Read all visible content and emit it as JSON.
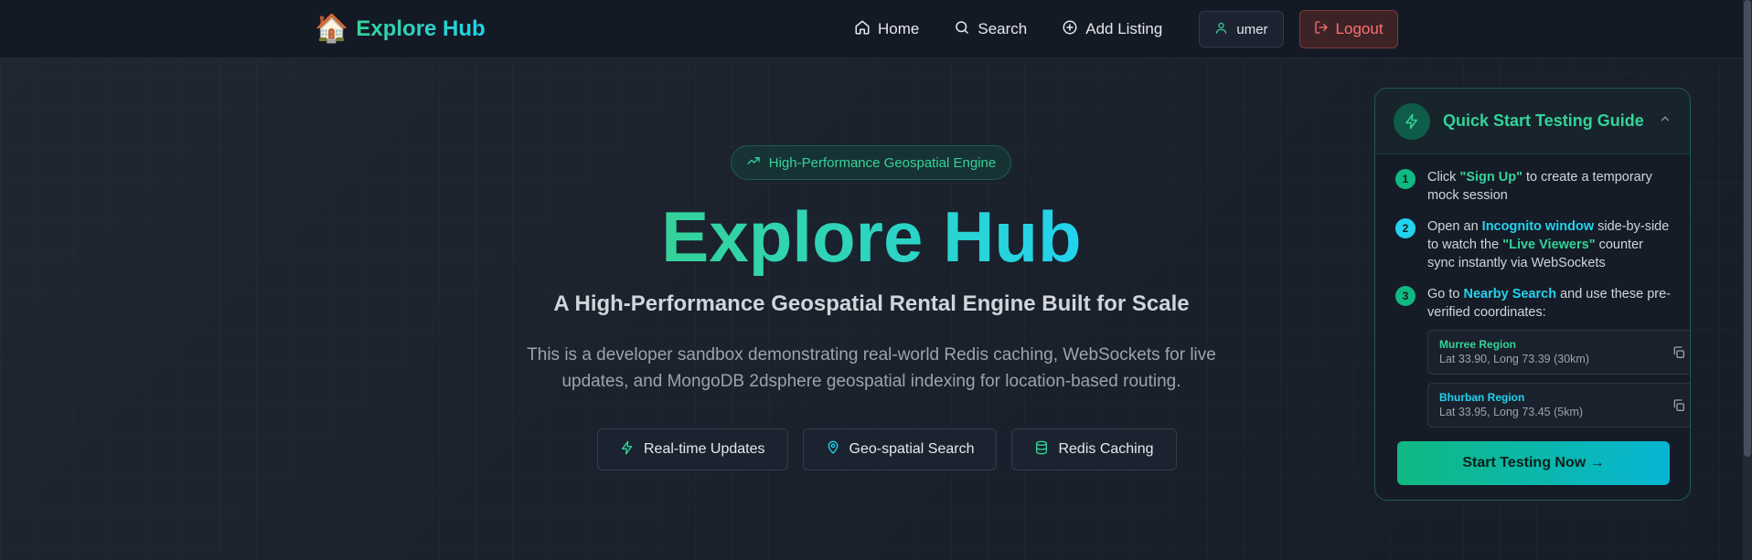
{
  "navbar": {
    "brand_icon": "🏠",
    "brand_name": "Explore Hub",
    "links": [
      {
        "label": "Home",
        "icon": "home-icon"
      },
      {
        "label": "Search",
        "icon": "search-icon"
      },
      {
        "label": "Add Listing",
        "icon": "plus-circle-icon"
      }
    ],
    "user_label": "umer",
    "logout_label": "Logout"
  },
  "hero": {
    "badge": "High-Performance Geospatial Engine",
    "title": "Explore Hub",
    "subtitle": "A High-Performance Geospatial Rental Engine Built for Scale",
    "description": "This is a developer sandbox demonstrating real-world Redis caching, WebSockets for live updates, and MongoDB 2dsphere geospatial indexing for location-based routing.",
    "features": [
      {
        "label": "Real-time Updates",
        "icon": "zap-icon"
      },
      {
        "label": "Geo-spatial Search",
        "icon": "map-pin-icon"
      },
      {
        "label": "Redis Caching",
        "icon": "database-icon"
      }
    ]
  },
  "guide": {
    "title": "Quick Start Testing Guide",
    "steps": [
      {
        "num": "1",
        "pre": "Click ",
        "highlight": "\"Sign Up\"",
        "post": " to create a temporary mock session"
      },
      {
        "num": "2",
        "pre": "Open an ",
        "highlight": "Incognito window",
        "mid": " side-by-side to watch the ",
        "highlight2": "\"Live Viewers\"",
        "post": " counter sync instantly via WebSockets"
      },
      {
        "num": "3",
        "pre": "Go to ",
        "highlight": "Nearby Search",
        "post": " and use these pre-verified coordinates:"
      }
    ],
    "coords": [
      {
        "name": "Murree Region",
        "detail": "Lat 33.90, Long 73.39 (30km)"
      },
      {
        "name": "Bhurban Region",
        "detail": "Lat 33.95, Long 73.45 (5km)"
      }
    ],
    "cta": "Start Testing Now →"
  },
  "colors": {
    "accent_green": "#34d399",
    "accent_cyan": "#22d3ee",
    "danger": "#f87171",
    "background": "#1c232e"
  }
}
